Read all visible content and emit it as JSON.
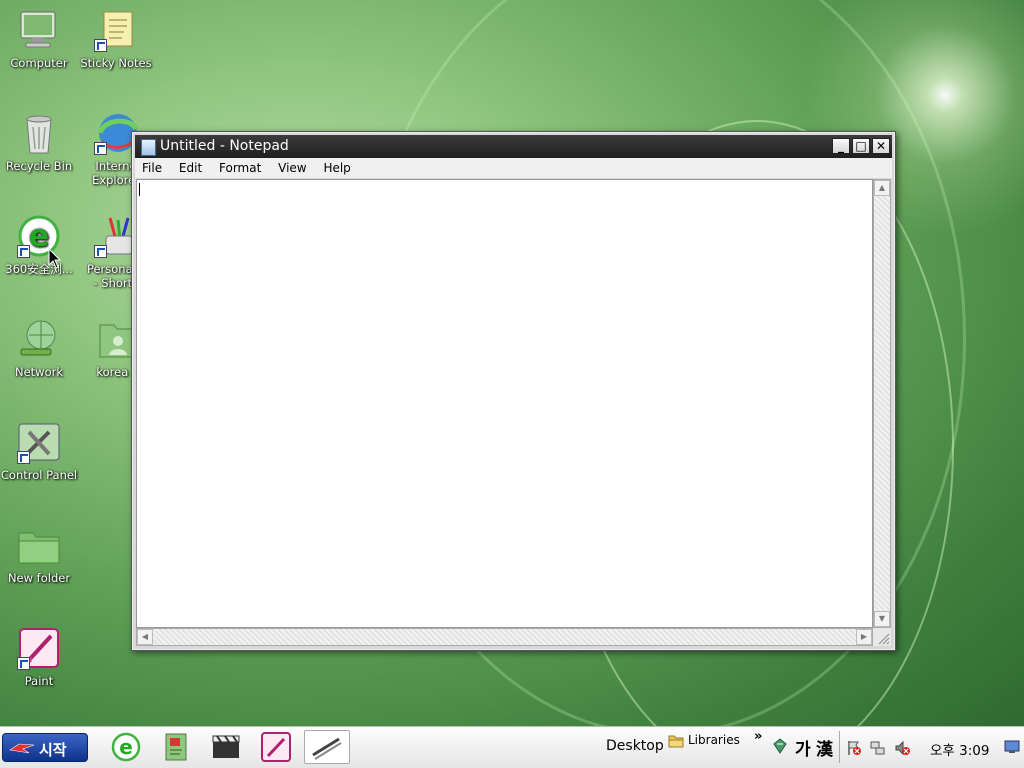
{
  "desktop": {
    "icons": [
      {
        "label": "Computer",
        "icon": "computer-icon"
      },
      {
        "label": "Sticky Notes",
        "icon": "sticky-notes-icon"
      },
      {
        "label": "Recycle Bin",
        "icon": "recycle-bin-icon"
      },
      {
        "label": "Internet Explorer",
        "line1": "Interne",
        "line2": "Explorer",
        "icon": "internet-explorer-icon"
      },
      {
        "label": "360安全浏...",
        "display": "360安全浏...",
        "icon": "360-browser-icon"
      },
      {
        "label": "Personalize - Shortcut",
        "line1": "Personaliz",
        "line2": "- Shortc",
        "icon": "personalize-icon"
      },
      {
        "label": "Network",
        "icon": "network-icon"
      },
      {
        "label": "korea",
        "display": "korea .",
        "icon": "user-folder-icon"
      },
      {
        "label": "Control Panel",
        "icon": "control-panel-icon"
      },
      {
        "label": "New folder",
        "icon": "folder-icon"
      },
      {
        "label": "Paint",
        "icon": "paint-icon"
      }
    ]
  },
  "notepad": {
    "title": "Untitled - Notepad",
    "menu": [
      "File",
      "Edit",
      "Format",
      "View",
      "Help"
    ],
    "content": "",
    "buttons": {
      "minimize": "_",
      "maximize": "□",
      "close": "✕"
    }
  },
  "taskbar": {
    "start_label": "시작",
    "toolbar_desktop": "Desktop",
    "toolbar_libraries": "Libraries",
    "overflow": "»",
    "ime_hangul": "가",
    "ime_hanja": "漢",
    "clock": "오후 3:09"
  },
  "colors": {
    "taskbar_start": "#1f49a8",
    "title_bar": "#2b2b2b",
    "desktop_green": "#5e9f55"
  }
}
